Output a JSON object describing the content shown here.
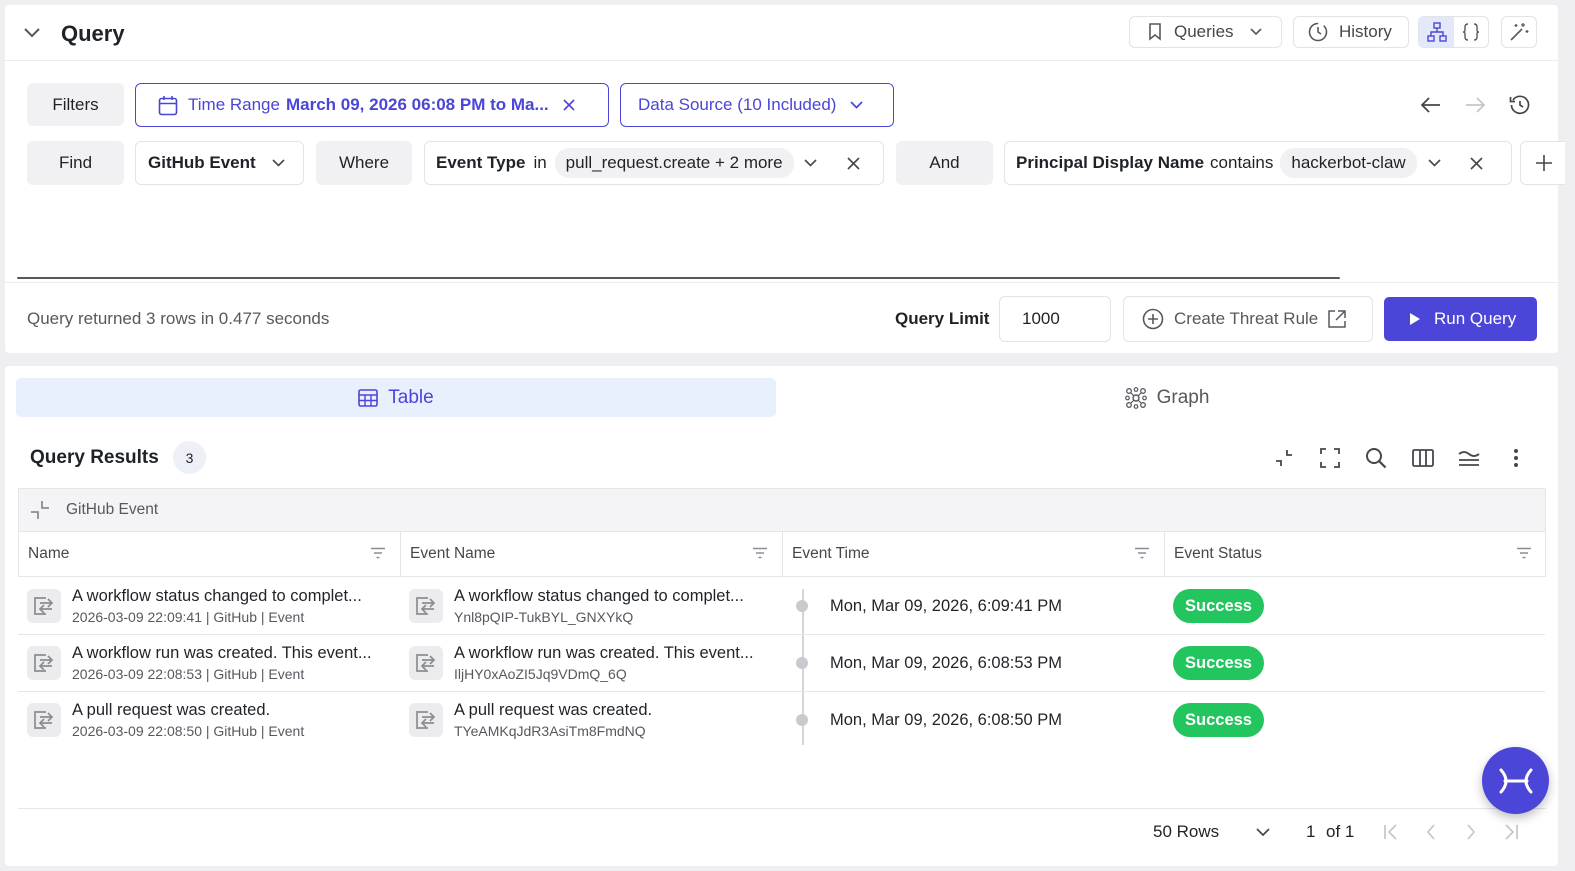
{
  "header": {
    "title": "Query",
    "queries_label": "Queries",
    "history_label": "History"
  },
  "filters": {
    "filters_label": "Filters",
    "time_range_label": "Time Range",
    "time_range_value": "March 09, 2026 06:08 PM to Ma...",
    "data_source_label": "Data Source (10 Included)"
  },
  "find_row": {
    "find_label": "Find",
    "entity": "GitHub Event",
    "where_label": "Where",
    "cond1_field": "Event Type",
    "cond1_op": "in",
    "cond1_value": "pull_request.create + 2 more",
    "and_label": "And",
    "cond2_field": "Principal Display Name",
    "cond2_op": "contains",
    "cond2_value": "hackerbot-claw"
  },
  "status_bar": {
    "summary": "Query returned 3 rows in 0.477 seconds",
    "limit_label": "Query Limit",
    "limit_value": "1000",
    "create_rule_label": "Create Threat Rule",
    "run_label": "Run Query"
  },
  "view_tabs": {
    "table": "Table",
    "graph": "Graph"
  },
  "results": {
    "title": "Query Results",
    "count": "3",
    "group_label": "GitHub Event",
    "columns": [
      "Name",
      "Event Name",
      "Event Time",
      "Event Status"
    ],
    "rows": [
      {
        "name": "A workflow status changed to complet...",
        "name_sub": "2026-03-09 22:09:41 | GitHub | Event",
        "event_name": "A workflow status changed to complet...",
        "event_id": "Ynl8pQIP-TukBYL_GNXYkQ",
        "time": "Mon, Mar 09, 2026, 6:09:41 PM",
        "status": "Success"
      },
      {
        "name": "A workflow run was created. This event...",
        "name_sub": "2026-03-09 22:08:53 | GitHub | Event",
        "event_name": "A workflow run was created. This event...",
        "event_id": "IljHY0xAoZI5Jq9VDmQ_6Q",
        "time": "Mon, Mar 09, 2026, 6:08:53 PM",
        "status": "Success"
      },
      {
        "name": "A pull request was created.",
        "name_sub": "2026-03-09 22:08:50 | GitHub | Event",
        "event_name": "A pull request was created.",
        "event_id": "TYeAMKqJdR3AsiTm8FmdNQ",
        "time": "Mon, Mar 09, 2026, 6:08:50 PM",
        "status": "Success"
      }
    ]
  },
  "pagination": {
    "rows_label": "50 Rows",
    "page_current": "1",
    "page_total": "of 1"
  },
  "colors": {
    "accent": "#4b45d8",
    "success": "#22c55e",
    "tab_active_bg": "#e8f0fe"
  }
}
